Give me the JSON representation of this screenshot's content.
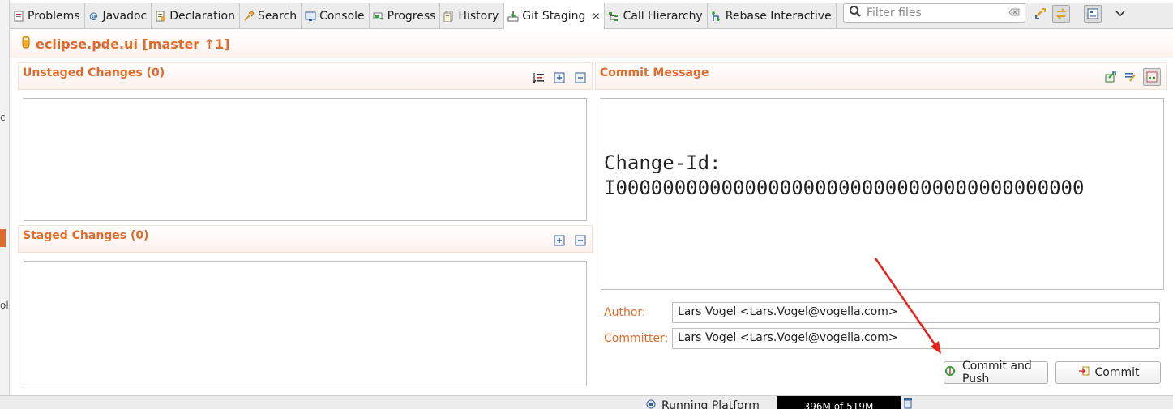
{
  "tabs": [
    {
      "label": "Problems",
      "icon": "problems-icon"
    },
    {
      "label": "Javadoc",
      "icon": "javadoc-icon"
    },
    {
      "label": "Declaration",
      "icon": "declaration-icon"
    },
    {
      "label": "Search",
      "icon": "search-icon"
    },
    {
      "label": "Console",
      "icon": "console-icon"
    },
    {
      "label": "Progress",
      "icon": "progress-icon"
    },
    {
      "label": "History",
      "icon": "history-icon"
    },
    {
      "label": "Git Staging",
      "icon": "git-staging-icon",
      "active": true
    },
    {
      "label": "Call Hierarchy",
      "icon": "call-hierarchy-icon"
    },
    {
      "label": "Rebase Interactive",
      "icon": "rebase-icon"
    }
  ],
  "filter": {
    "placeholder": "Filter files"
  },
  "repo": {
    "title": "eclipse.pde.ui [master ↑1]"
  },
  "unstaged": {
    "title": "Unstaged Changes (0)"
  },
  "staged": {
    "title": "Staged Changes (0)"
  },
  "commit": {
    "title": "Commit Message",
    "message": "Change-Id:\nI0000000000000000000000000000000000000000",
    "author_label": "Author:",
    "author_value": "Lars Vogel <Lars.Vogel@vogella.com>",
    "committer_label": "Committer:",
    "committer_value": "Lars Vogel <Lars.Vogel@vogella.com>",
    "commit_and_push_label": "Commit and Push",
    "commit_label": "Commit"
  },
  "status": {
    "running_label": "Running Platform",
    "heap": "396M of 519M"
  },
  "colors": {
    "accent": "#e26a2a",
    "annotation_arrow": "#e8231c"
  }
}
